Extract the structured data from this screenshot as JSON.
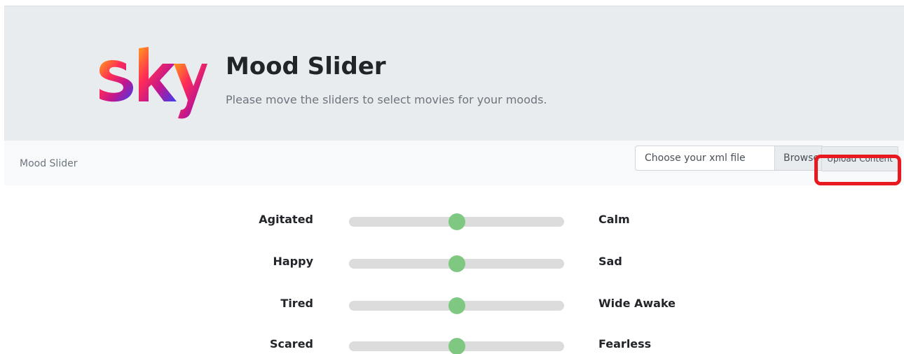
{
  "header": {
    "logo_text": "sky",
    "title": "Mood Slider",
    "subtitle": "Please move the sliders to select movies for your moods."
  },
  "navbar": {
    "brand": "Mood Slider",
    "file_input": {
      "placeholder": "Choose your xml file",
      "browse_label": "Browse"
    },
    "upload_button": "Upload Content"
  },
  "sliders": [
    {
      "left_label": "Agitated",
      "right_label": "Calm",
      "value": 0.5
    },
    {
      "left_label": "Happy",
      "right_label": "Sad",
      "value": 0.5
    },
    {
      "left_label": "Tired",
      "right_label": "Wide Awake",
      "value": 0.5
    },
    {
      "left_label": "Scared",
      "right_label": "Fearless",
      "value": 0.5
    }
  ],
  "colors": {
    "hero_background": "#e9ecef",
    "navbar_background": "#f8f9fa",
    "slider_track": "#dcdcdc",
    "slider_thumb": "#7ec882",
    "highlight_annotation": "#e8191f"
  }
}
